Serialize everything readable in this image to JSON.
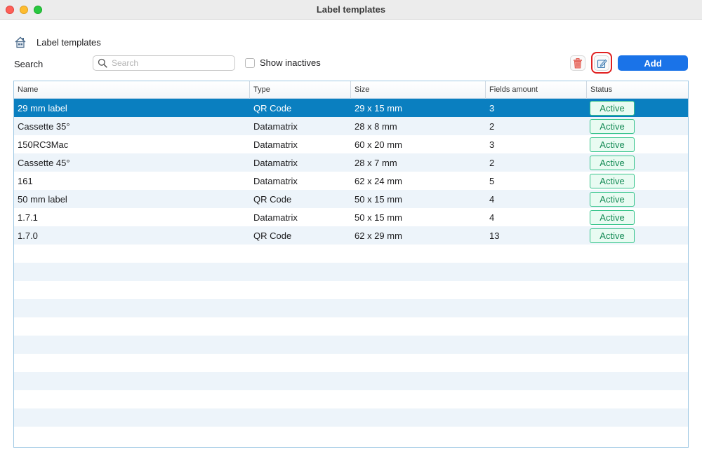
{
  "window": {
    "title": "Label templates"
  },
  "header": {
    "title": "Label templates",
    "icon": "home-icon"
  },
  "toolbar": {
    "search_label": "Search",
    "search_placeholder": "Search",
    "search_value": "",
    "show_inactives_label": "Show inactives",
    "show_inactives_checked": false,
    "add_label": "Add",
    "delete_icon": "trash-icon",
    "edit_icon": "edit-icon"
  },
  "colors": {
    "accent": "#1a73e8",
    "selected_row": "#0a7fc0",
    "active_badge": "#34c38a",
    "highlight": "#e02020"
  },
  "table": {
    "columns": [
      "Name",
      "Type",
      "Size",
      "Fields amount",
      "Status"
    ],
    "rows": [
      {
        "name": "29 mm label",
        "type": "QR Code",
        "size": "29 x 15 mm",
        "fields": "3",
        "status": "Active",
        "selected": true
      },
      {
        "name": "Cassette 35°",
        "type": "Datamatrix",
        "size": "28 x 8 mm",
        "fields": "2",
        "status": "Active"
      },
      {
        "name": "150RC3Mac",
        "type": "Datamatrix",
        "size": "60 x 20 mm",
        "fields": "3",
        "status": "Active"
      },
      {
        "name": "Cassette 45°",
        "type": "Datamatrix",
        "size": "28 x 7 mm",
        "fields": "2",
        "status": "Active"
      },
      {
        "name": "161",
        "type": "Datamatrix",
        "size": "62 x 24 mm",
        "fields": "5",
        "status": "Active"
      },
      {
        "name": "50 mm label",
        "type": "QR Code",
        "size": "50 x 15 mm",
        "fields": "4",
        "status": "Active"
      },
      {
        "name": "1.7.1",
        "type": "Datamatrix",
        "size": "50 x 15 mm",
        "fields": "4",
        "status": "Active"
      },
      {
        "name": "1.7.0",
        "type": "QR Code",
        "size": "62 x 29 mm",
        "fields": "13",
        "status": "Active"
      }
    ]
  }
}
